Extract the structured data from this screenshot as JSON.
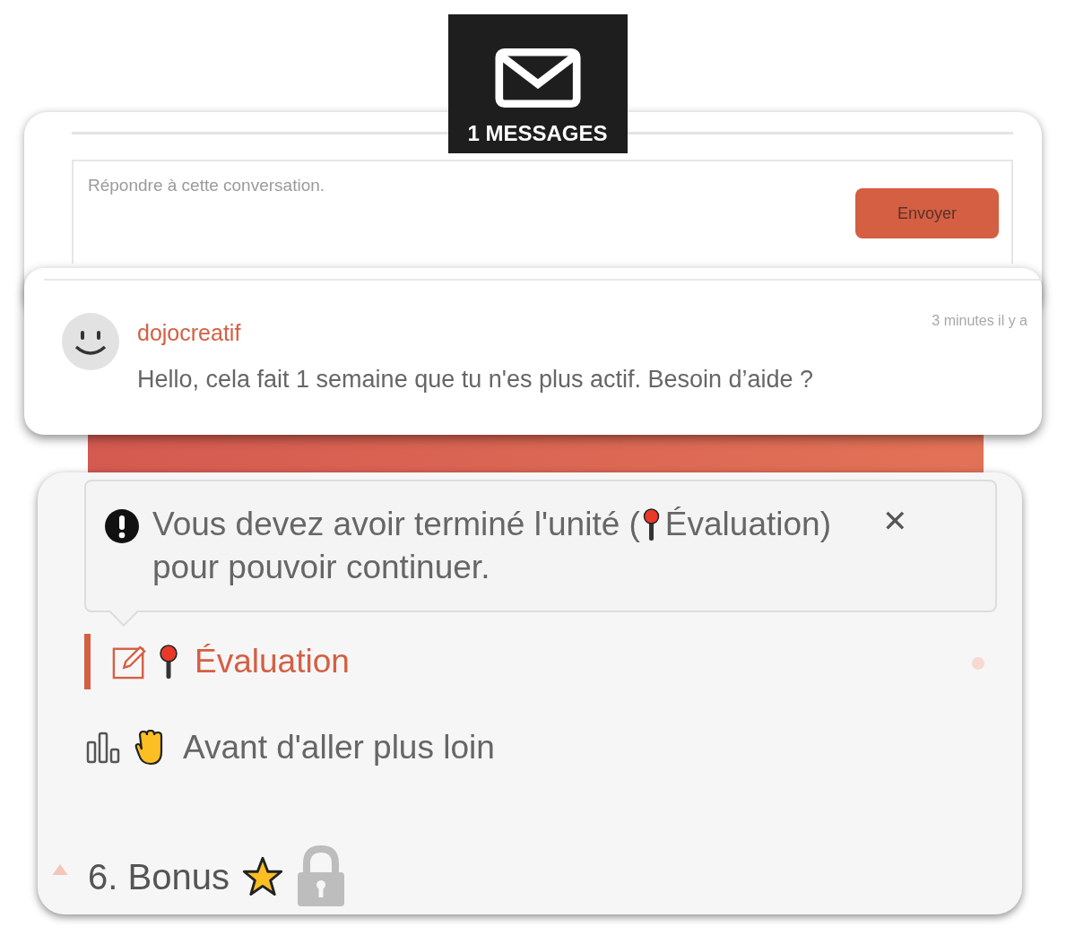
{
  "header": {
    "title": "1 MESSAGES"
  },
  "reply": {
    "placeholder": "Répondre à cette conversation.",
    "button": "Envoyer"
  },
  "message": {
    "author": "dojocreatif",
    "time": "3 minutes il y a",
    "text": "Hello, cela fait 1 semaine que tu n'es plus actif. Besoin d’aide ?"
  },
  "alert": {
    "before": "Vous devez avoir terminé l'unité (",
    "after": "Évaluation)",
    "line2": "pour pouvoir continuer.",
    "close": "✕"
  },
  "units": [
    {
      "kind": "evaluation",
      "label": "Évaluation",
      "selected": true
    },
    {
      "kind": "stats",
      "label": "Avant d'aller plus loin",
      "selected": false
    }
  ],
  "section": {
    "title": "6. Bonus",
    "locked": true
  }
}
